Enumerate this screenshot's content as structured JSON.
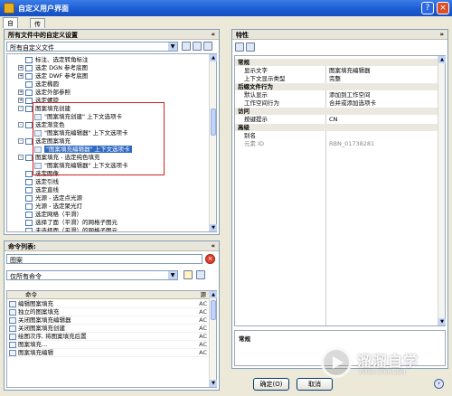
{
  "window": {
    "title": "自定义用户界面",
    "help_glyph": "?",
    "close_glyph": "×"
  },
  "tabs": [
    {
      "label": "自定义",
      "active": true
    },
    {
      "label": "传输",
      "active": false
    }
  ],
  "customizations_panel": {
    "header": "所有文件中的自定义设置",
    "collapse_glyph": "«",
    "filter_value": "所有自定义文件",
    "tree": [
      {
        "label": "标注、选定转角标注",
        "indent": 2,
        "expander": "",
        "selected": false
      },
      {
        "label": "选定 DGN 参考底图",
        "indent": 2,
        "expander": "+",
        "selected": false
      },
      {
        "label": "选定 DWF 参考底图",
        "indent": 2,
        "expander": "+",
        "selected": false
      },
      {
        "label": "选定椭圆",
        "indent": 2,
        "expander": "",
        "selected": false
      },
      {
        "label": "选定外部参照",
        "indent": 2,
        "expander": "+",
        "selected": false
      },
      {
        "label": "选定螺旋",
        "indent": 2,
        "expander": "+",
        "selected": false
      },
      {
        "label": "图案填充创建",
        "indent": 2,
        "expander": "-",
        "selected": false
      },
      {
        "label": "\"图案填充创建\" 上下文选项卡",
        "indent": 3,
        "expander": "",
        "selected": false
      },
      {
        "label": "选定渐变色",
        "indent": 2,
        "expander": "-",
        "selected": false
      },
      {
        "label": "\"图案填充编辑器\" 上下文选项卡",
        "indent": 3,
        "expander": "",
        "selected": false
      },
      {
        "label": "选定图案填充",
        "indent": 2,
        "expander": "-",
        "selected": false
      },
      {
        "label": "\"图案填充编辑器\" 上下文选项卡",
        "indent": 3,
        "expander": "",
        "selected": true
      },
      {
        "label": "图案填充 - 选定纯色填充",
        "indent": 2,
        "expander": "-",
        "selected": false
      },
      {
        "label": "\"图案填充编辑器\" 上下文选项卡",
        "indent": 3,
        "expander": "",
        "selected": false
      },
      {
        "label": "选定图像",
        "indent": 2,
        "expander": "",
        "selected": false
      },
      {
        "label": "选定引线",
        "indent": 2,
        "expander": "",
        "selected": false
      },
      {
        "label": "选定直线",
        "indent": 2,
        "expander": "",
        "selected": false
      },
      {
        "label": "光源 - 选定点光源",
        "indent": 2,
        "expander": "",
        "selected": false
      },
      {
        "label": "光源 - 选定聚光灯",
        "indent": 2,
        "expander": "",
        "selected": false
      },
      {
        "label": "选定网格（平滑）",
        "indent": 2,
        "expander": "",
        "selected": false
      },
      {
        "label": "选择了面（平滑）的网格子图元",
        "indent": 2,
        "expander": "",
        "selected": false
      },
      {
        "label": "未选择面（平滑）的网格子图元",
        "indent": 2,
        "expander": "",
        "selected": false
      }
    ]
  },
  "command_list_panel": {
    "header": "命令列表:",
    "collapse_glyph": "«",
    "search_value": "图案",
    "filter_value": "仅所有命令",
    "column_command": "命令",
    "column_source": "源",
    "rows": [
      {
        "name": "编辑图案填充",
        "source": "AC"
      },
      {
        "name": "独立的图案填充",
        "source": "AC"
      },
      {
        "name": "关闭图案填充编辑器",
        "source": "AC"
      },
      {
        "name": "关闭图案填充创建",
        "source": "AC"
      },
      {
        "name": "绘图次序, 将图案填充后置",
        "source": "AC"
      },
      {
        "name": "图案填充...",
        "source": "AC"
      },
      {
        "name": "图案填充编辑",
        "source": "AC"
      }
    ]
  },
  "properties_panel": {
    "header": "特性",
    "collapse_glyph": "»",
    "rows": [
      {
        "kind": "cat",
        "key": "常规",
        "value": ""
      },
      {
        "kind": "prop",
        "key": "显示文字",
        "value": "图案填充编辑器"
      },
      {
        "kind": "prop",
        "key": "上下文显示类型",
        "value": "完整"
      },
      {
        "kind": "cat",
        "key": "后缀文件行为",
        "value": ""
      },
      {
        "kind": "prop",
        "key": "默认显示",
        "value": "添加到工作空间"
      },
      {
        "kind": "prop",
        "key": "工作空间行为",
        "value": "合并或添加选项卡"
      },
      {
        "kind": "cat",
        "key": "访问",
        "value": ""
      },
      {
        "kind": "prop",
        "key": "按键提示",
        "value": "CN"
      },
      {
        "kind": "cat",
        "key": "高级",
        "value": ""
      },
      {
        "kind": "prop",
        "key": "别名",
        "value": ""
      },
      {
        "kind": "grey",
        "key": "元素 ID",
        "value": "RBN_01738281"
      }
    ],
    "description_header": "常规"
  },
  "buttons": {
    "ok": "确定(O)",
    "cancel": "取消",
    "next_glyph": "›"
  },
  "watermark": {
    "text": "溜溜自学",
    "url": "ZIXUE.3066.COM"
  },
  "colors": {
    "titlebar": "#1a5ad0",
    "selection": "#316ac5",
    "highlight_box": "#d02020"
  }
}
